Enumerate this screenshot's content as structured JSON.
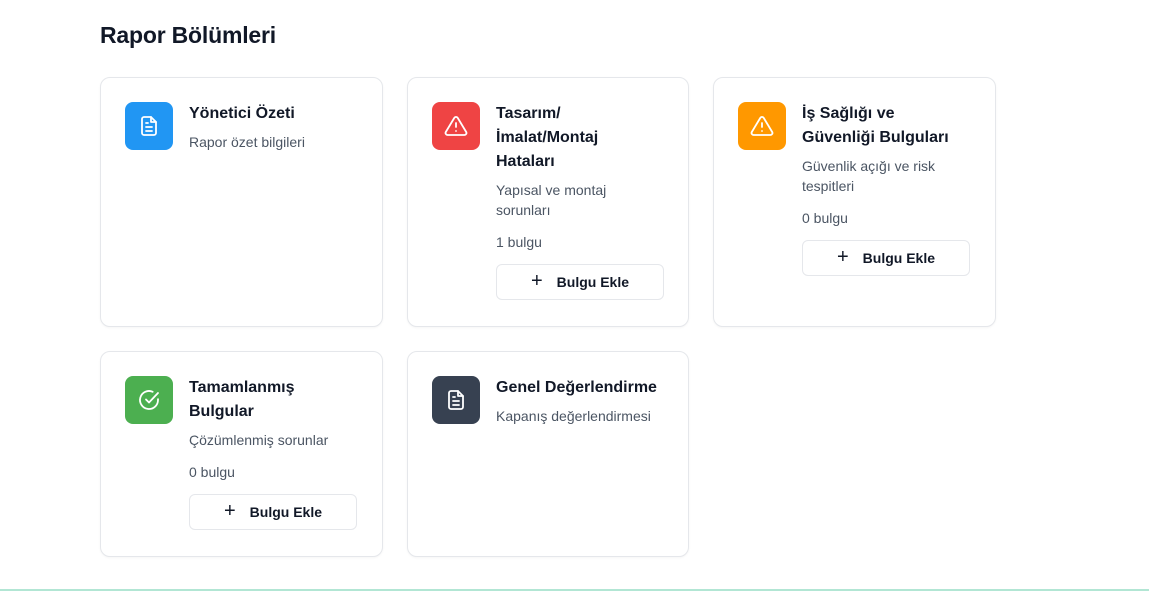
{
  "section": {
    "title": "Rapor Bölümleri"
  },
  "colors": {
    "blue": "#2196f3",
    "red": "#ef4444",
    "orange": "#ff9800",
    "green": "#4caf50",
    "dark": "#374151"
  },
  "cards": [
    {
      "title": "Yönetici Özeti",
      "description": "Rapor özet bilgileri",
      "icon": "document-icon"
    },
    {
      "title": "Tasarım/ İmalat/Montaj Hataları",
      "description": "Yapısal ve montaj sorunları",
      "count": "1 bulgu",
      "button": "Bulgu Ekle",
      "icon": "warning-icon"
    },
    {
      "title": "İş Sağlığı ve Güvenliği Bulguları",
      "description": "Güvenlik açığı ve risk tespitleri",
      "count": "0 bulgu",
      "button": "Bulgu Ekle",
      "icon": "warning-icon"
    },
    {
      "title": "Tamamlanmış Bulgular",
      "description": "Çözümlenmiş sorunlar",
      "count": "0 bulgu",
      "button": "Bulgu Ekle",
      "icon": "check-circle-icon"
    },
    {
      "title": "Genel Değerlendirme",
      "description": "Kapanış değerlendirmesi",
      "icon": "document-icon"
    }
  ]
}
